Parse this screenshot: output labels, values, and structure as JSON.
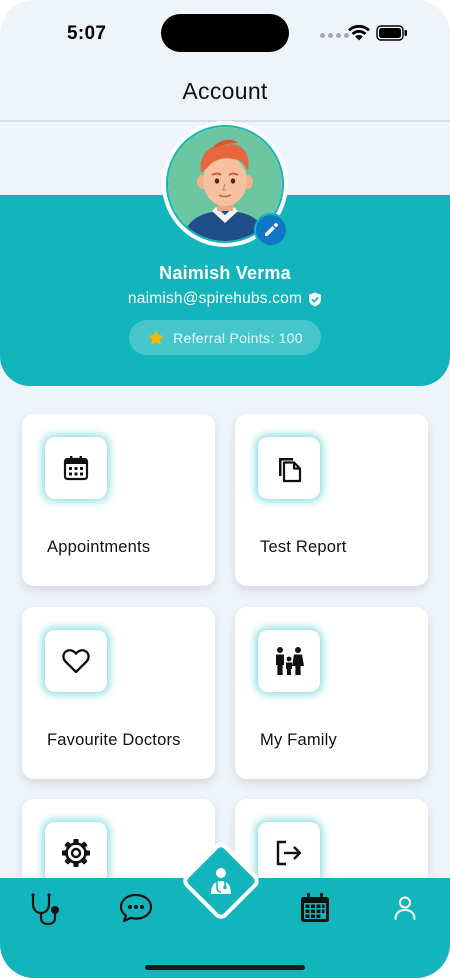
{
  "status_bar": {
    "time": "5:07"
  },
  "header": {
    "title": "Account"
  },
  "profile": {
    "name": "Naimish Verma",
    "email": "naimish@spirehubs.com",
    "referral_label": "Referral Points: 100"
  },
  "menu": {
    "cards": [
      {
        "label": "Appointments",
        "icon": "calendar-icon"
      },
      {
        "label": "Test Report",
        "icon": "copy-documents-icon"
      },
      {
        "label": "Favourite Doctors",
        "icon": "heart-icon"
      },
      {
        "label": "My Family",
        "icon": "family-icon"
      },
      {
        "label": "",
        "icon": "gear-icon"
      },
      {
        "label": "",
        "icon": "logout-icon"
      }
    ]
  },
  "bottom_nav": {
    "items": [
      "stethoscope-icon",
      "chat-icon",
      "doctor-icon",
      "calendar-icon",
      "user-icon"
    ],
    "active": "user-icon"
  },
  "colors": {
    "accent": "#12b5bb",
    "edit_badge": "#0f77c6",
    "star": "#f5b800",
    "background": "#eff4fb"
  }
}
